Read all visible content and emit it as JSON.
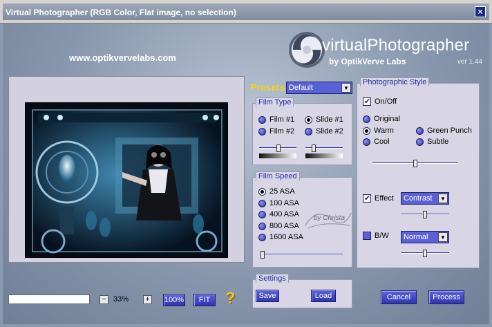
{
  "window": {
    "title": "Virtual Photographer (RGB Color, Flat image, no selection)",
    "close_label": "×"
  },
  "header": {
    "website": "www.optikvervelabs.com",
    "logo_title": "virtualPhotographer",
    "logo_by": "by OptikVerve Labs",
    "logo_version": "ver 1.44"
  },
  "preview": {
    "zoom_value": "33%",
    "zoom_minus": "−",
    "zoom_plus": "+",
    "btn_100": "100%",
    "btn_fit": "FIT",
    "help": "?"
  },
  "presets": {
    "label": "Presets",
    "value": "Default"
  },
  "film_type": {
    "title": "Film Type",
    "options": [
      "Film #1",
      "Film #2",
      "Slide #1",
      "Slide #2"
    ],
    "selected": "Slide #1",
    "slider1": 0.52,
    "slider2": 0.22
  },
  "film_speed": {
    "title": "Film Speed",
    "options": [
      "25 ASA",
      "100 ASA",
      "400 ASA",
      "800 ASA",
      "1600 ASA"
    ],
    "selected": "25 ASA",
    "slider": 0.02,
    "stamp": "by Christa"
  },
  "photo_style": {
    "title": "Photographic Style",
    "onoff_label": "On/Off",
    "onoff_checked": true,
    "options": [
      "Original",
      "Warm",
      "Cool",
      "Green Punch",
      "Subtle"
    ],
    "selected": "Warm",
    "slider": 0.5,
    "effect_label": "Effect",
    "effect_checked": true,
    "effect_value": "Contrast",
    "effect_slider": 0.5,
    "bw_label": "B/W",
    "bw_checked": false,
    "bw_value": "Normal",
    "bw_slider": 0.5
  },
  "settings": {
    "title": "Settings",
    "save_label": "Save",
    "load_label": "Load"
  },
  "actions": {
    "cancel_label": "Cancel",
    "process_label": "Process"
  },
  "colors": {
    "accent": "#3035b0",
    "panel": "#d8d6e4",
    "title_text": "#1f2aa0",
    "presets_label": "#f2d21e"
  }
}
